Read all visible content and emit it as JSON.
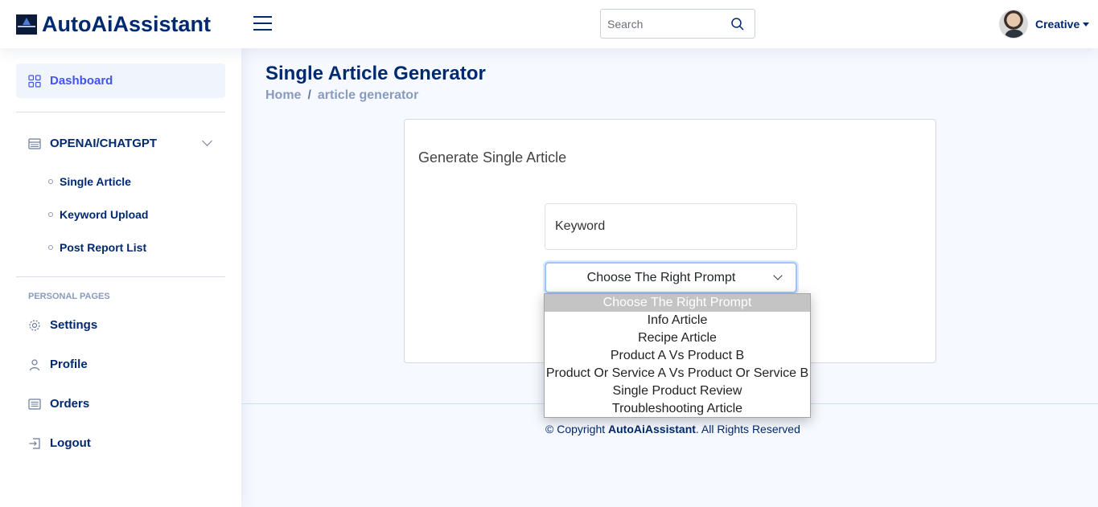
{
  "header": {
    "brand": "AutoAiAssistant",
    "search_placeholder": "Search",
    "user_name": "Creative"
  },
  "sidebar": {
    "dashboard": "Dashboard",
    "openai_group": "OPENAI/CHATGPT",
    "sub_items": [
      "Single Article",
      "Keyword Upload",
      "Post Report List"
    ],
    "heading": "PERSONAL PAGES",
    "personal": [
      "Settings",
      "Profile",
      "Orders",
      "Logout"
    ]
  },
  "main": {
    "title": "Single Article Generator",
    "breadcrumb": [
      "Home",
      "article generator"
    ],
    "card_title": "Generate Single Article",
    "keyword_placeholder": "Keyword",
    "select_value": "Choose The Right Prompt",
    "options": [
      "Choose The Right Prompt",
      "Info Article",
      "Recipe Article",
      "Product A Vs Product B",
      "Product Or Service A Vs Product Or Service B",
      "Single Product Review",
      "Troubleshooting Article"
    ]
  },
  "footer": {
    "prefix": "© Copyright ",
    "brand": "AutoAiAssistant",
    "suffix": ". All Rights Reserved"
  }
}
